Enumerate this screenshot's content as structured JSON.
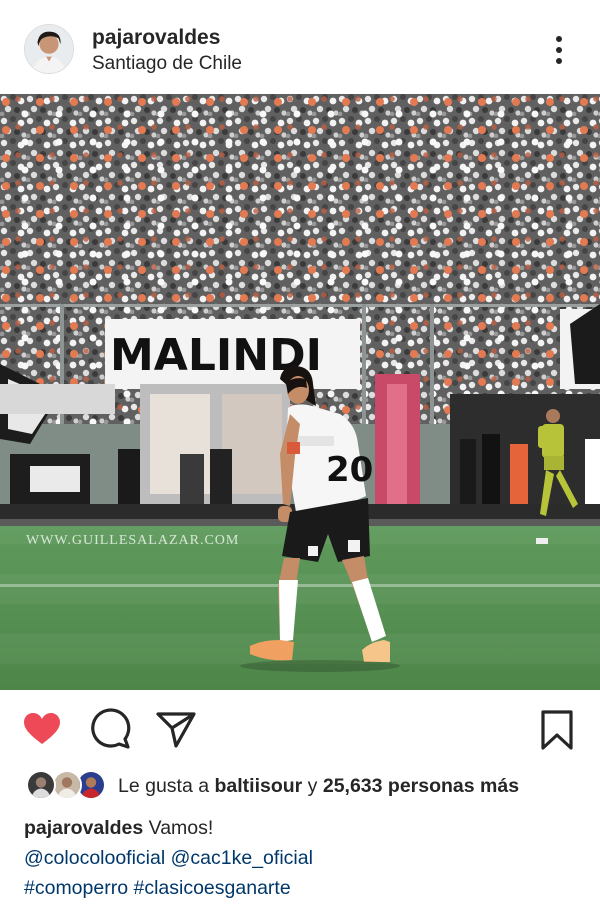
{
  "post": {
    "username": "pajarovaldes",
    "location": "Santiago de Chile",
    "image": {
      "alt": "Soccer player number 20 on the pitch in front of a crowd",
      "watermark": "WWW.GUILLESALAZAR.COM",
      "jersey_number": "20",
      "banner_text": "MALINDI"
    },
    "likes": {
      "prefix": "Le gusta a ",
      "user": "baltiisour",
      "middle": " y ",
      "count": "25,633 personas más"
    },
    "caption": {
      "username": "pajarovaldes",
      "text": " Vamos!",
      "mentions": [
        "@colocolooficial",
        "@cac1ke_oficial"
      ],
      "hashtags": [
        "#comoperro",
        "#clasicoesganarte"
      ]
    }
  },
  "icons": {
    "like": "heart-filled-icon",
    "comment": "comment-bubble-icon",
    "share": "paper-plane-icon",
    "save": "bookmark-icon",
    "more": "vertical-dots-icon"
  },
  "colors": {
    "like_red": "#ed4956",
    "link_blue": "#00376b",
    "text": "#262626"
  }
}
